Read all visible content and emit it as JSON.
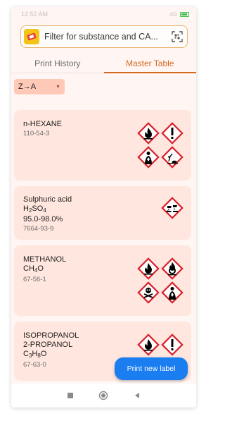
{
  "status": {
    "time": "12:52 AM",
    "signal": "4G"
  },
  "search": {
    "placeholder": "Filter for substance and CA..."
  },
  "tabs": [
    {
      "label": "Print History",
      "active": false
    },
    {
      "label": "Master Table",
      "active": true
    }
  ],
  "sort": {
    "label": "Z→A"
  },
  "substances": [
    {
      "name": "n-HEXANE",
      "cas": "110-54-3",
      "pictograms": [
        "flame",
        "exclamation",
        "health-hazard",
        "environment"
      ]
    },
    {
      "name": "Sulphuric acid",
      "formula_parts": [
        "H",
        "2",
        "SO",
        "4"
      ],
      "purity": "95.0-98.0%",
      "cas": "7664-93-9",
      "pictograms": [
        "corrosion"
      ]
    },
    {
      "name": "METHANOL",
      "formula_parts": [
        "CH",
        "4",
        "O",
        ""
      ],
      "cas": "67-56-1",
      "pictograms": [
        "flame",
        "oxidizer",
        "skull",
        "health-hazard"
      ]
    },
    {
      "name_lines": [
        "ISOPROPANOL",
        "2-PROPANOL"
      ],
      "formula_parts": [
        "C",
        "3",
        "H",
        "8",
        "O"
      ],
      "cas": "67-63-0",
      "pictograms": [
        "flame",
        "exclamation"
      ]
    }
  ],
  "fab": {
    "label": "Print new label"
  },
  "colors": {
    "accent": "#d2691e",
    "fab": "#1a7df0",
    "card": "#ffe6de",
    "ghs_red": "#d8202a"
  }
}
